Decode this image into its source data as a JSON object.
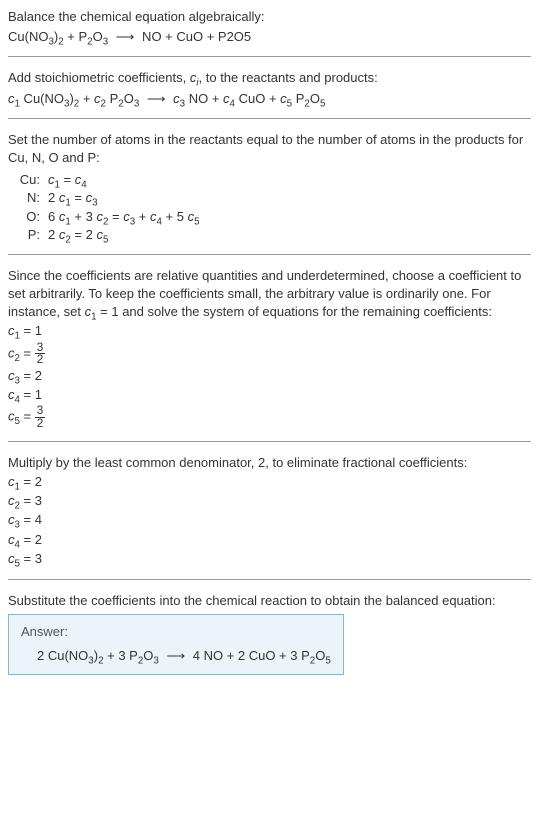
{
  "section1": {
    "title": "Balance the chemical equation algebraically:",
    "equation": "Cu(NO₃)₂ + P₂O₃  ⟶  NO + CuO + P2O5"
  },
  "section2": {
    "title_a": "Add stoichiometric coefficients, ",
    "title_b": ", to the reactants and products:",
    "ci": "cᵢ",
    "equation": "c₁ Cu(NO₃)₂ + c₂ P₂O₃  ⟶  c₃ NO + c₄ CuO + c₅ P₂O₅"
  },
  "section3": {
    "title": "Set the number of atoms in the reactants equal to the number of atoms in the products for Cu, N, O and P:",
    "rows": [
      {
        "label": "Cu:",
        "eq": "c₁ = c₄"
      },
      {
        "label": "N:",
        "eq": "2 c₁ = c₃"
      },
      {
        "label": "O:",
        "eq": "6 c₁ + 3 c₂ = c₃ + c₄ + 5 c₅"
      },
      {
        "label": "P:",
        "eq": "2 c₂ = 2 c₅"
      }
    ]
  },
  "section4": {
    "title": "Since the coefficients are relative quantities and underdetermined, choose a coefficient to set arbitrarily. To keep the coefficients small, the arbitrary value is ordinarily one. For instance, set c₁ = 1 and solve the system of equations for the remaining coefficients:",
    "line1": "c₁ = 1",
    "line2_pre": "c₂ = ",
    "line2_num": "3",
    "line2_den": "2",
    "line3": "c₃ = 2",
    "line4": "c₄ = 1",
    "line5_pre": "c₅ = ",
    "line5_num": "3",
    "line5_den": "2"
  },
  "section5": {
    "title": "Multiply by the least common denominator, 2, to eliminate fractional coefficients:",
    "lines": [
      "c₁ = 2",
      "c₂ = 3",
      "c₃ = 4",
      "c₄ = 2",
      "c₅ = 3"
    ]
  },
  "section6": {
    "title": "Substitute the coefficients into the chemical reaction to obtain the balanced equation:",
    "answer_label": "Answer:",
    "answer_eq": "2 Cu(NO₃)₂ + 3 P₂O₃  ⟶  4 NO + 2 CuO + 3 P₂O₅"
  },
  "chart_data": {
    "type": "table",
    "title": "Balanced chemical equation coefficients",
    "species": [
      "Cu(NO3)2",
      "P2O3",
      "NO",
      "CuO",
      "P2O5"
    ],
    "side": [
      "reactant",
      "reactant",
      "product",
      "product",
      "product"
    ],
    "coefficients_initial": [
      1,
      1.5,
      2,
      1,
      1.5
    ],
    "coefficients_balanced": [
      2,
      3,
      4,
      2,
      3
    ],
    "atom_balance": {
      "Cu": "c1 = c4",
      "N": "2c1 = c3",
      "O": "6c1 + 3c2 = c3 + c4 + 5c5",
      "P": "2c2 = 2c5"
    }
  }
}
